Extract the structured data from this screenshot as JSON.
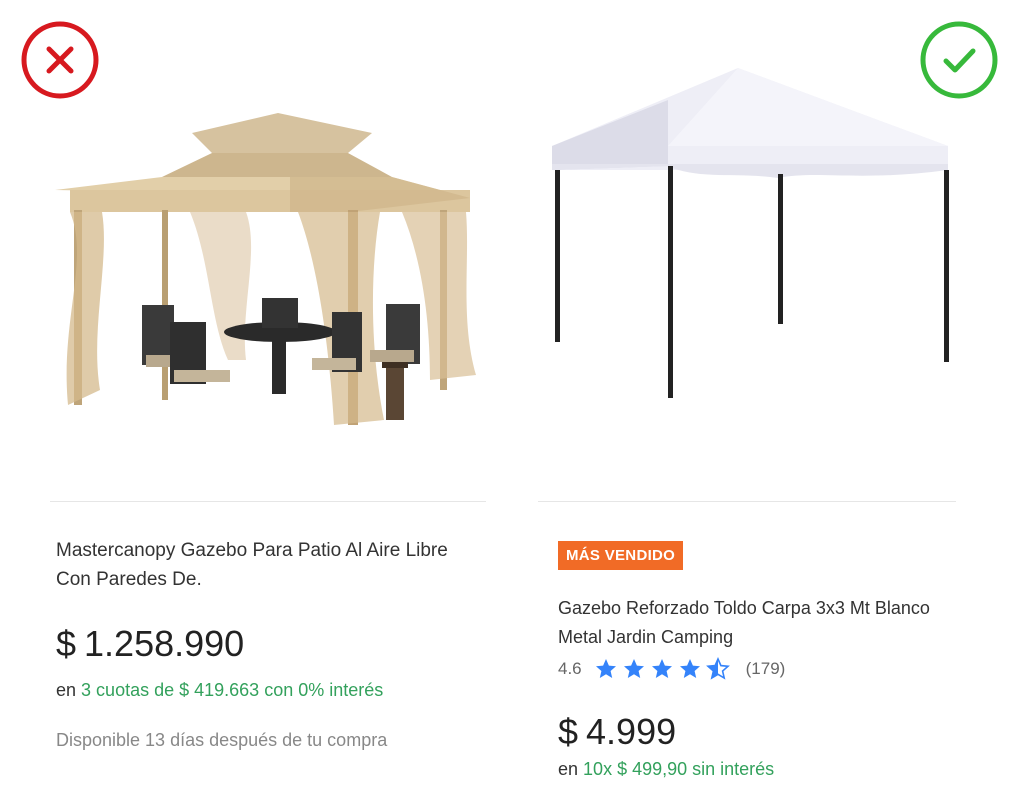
{
  "colors": {
    "bad": "#d7191f",
    "good": "#37b93b",
    "badge_bg": "#f16b26",
    "installment_green": "#33a15c",
    "star_blue": "#3483fa"
  },
  "icons": {
    "bad_mark": "close-circle-icon",
    "good_mark": "check-circle-icon"
  },
  "products": [
    {
      "image": "beige-gazebo-with-nets-and-dining-set",
      "title": "Mastercanopy Gazebo Para Patio Al Aire Libre Con Paredes De.",
      "currency": "$",
      "price": "1.258.990",
      "installment_prefix": "en",
      "installment_highlight": "3 cuotas de $ 419.663 con 0% interés",
      "availability": "Disponible 13 días después de tu compra"
    },
    {
      "image": "white-canopy-tent-gazebo",
      "badge": "MÁS VENDIDO",
      "title": "Gazebo Reforzado Toldo Carpa 3x3 Mt Blanco Metal Jardin Camping",
      "rating_value": "4.6",
      "rating": 4.6,
      "reviews": "(179)",
      "currency": "$",
      "price": "4.999",
      "installment_prefix": "en",
      "installment_highlight": "10x $ 499,90 sin interés"
    }
  ]
}
